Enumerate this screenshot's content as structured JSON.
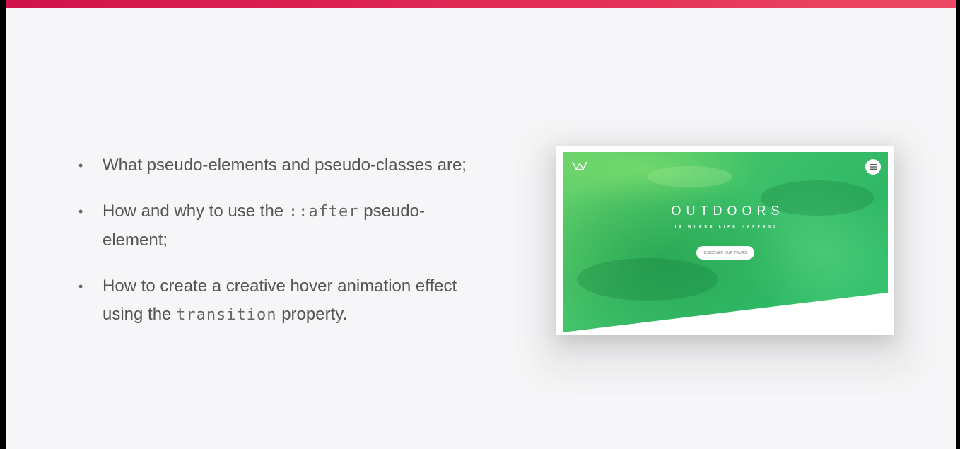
{
  "bullets": [
    {
      "text_before": "What pseudo-elements and pseudo-classes are;",
      "code": "",
      "text_after": "",
      "text_line2": ""
    },
    {
      "text_before": "How and why to use the ",
      "code": "::after",
      "text_after": " pseudo-",
      "text_line2": "element;"
    },
    {
      "text_before": "How to create a creative hover animation effect",
      "code": "",
      "text_after": "",
      "text_line2": "using the ",
      "code2": "transition",
      "text_line2_after": " property."
    }
  ],
  "bullet_marker": "•",
  "preview": {
    "title": "OUTDOORS",
    "subtitle": "IS WHERE LIFE HAPPENS",
    "button_label": "DISCOVER OUR TOURS",
    "logo_icon": "crown-logo-icon",
    "menu_icon": "hamburger-menu-icon"
  },
  "colors": {
    "accent_bar": "#d0124a",
    "background": "#f6f6f8",
    "hero_green": "#3fc16a"
  }
}
